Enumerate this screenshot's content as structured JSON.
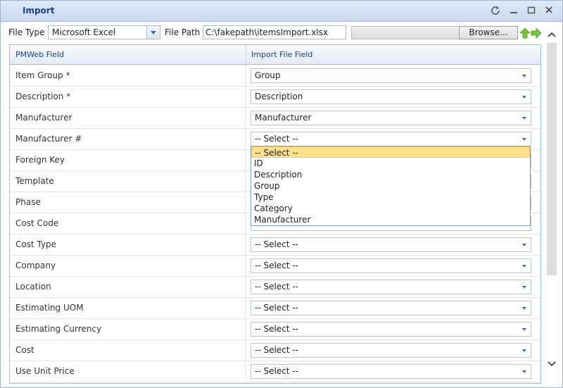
{
  "window": {
    "title": "Import"
  },
  "toolbar": {
    "file_type_label": "File Type",
    "file_type_value": "Microsoft Excel",
    "file_path_label": "File Path",
    "file_path_value": "C:\\fakepath\\itemsImport.xlsx",
    "browse_label": "Browse..."
  },
  "grid": {
    "col1": "PMWeb Field",
    "col2": "Import File Field",
    "rows": [
      {
        "field": "Item Group  *",
        "value": "Group"
      },
      {
        "field": "Description  *",
        "value": "Description"
      },
      {
        "field": "Manufacturer",
        "value": "Manufacturer"
      },
      {
        "field": "Manufacturer #",
        "value": "-- Select --"
      },
      {
        "field": "Foreign Key",
        "value": ""
      },
      {
        "field": "Template",
        "value": ""
      },
      {
        "field": "Phase",
        "value": ""
      },
      {
        "field": "Cost Code",
        "value": ""
      },
      {
        "field": "Cost Type",
        "value": "-- Select --"
      },
      {
        "field": "Company",
        "value": "-- Select --"
      },
      {
        "field": "Location",
        "value": "-- Select --"
      },
      {
        "field": "Estimating UOM",
        "value": "-- Select --"
      },
      {
        "field": "Estimating Currency",
        "value": "-- Select --"
      },
      {
        "field": "Cost",
        "value": "-- Select --"
      },
      {
        "field": "Use Unit Price",
        "value": "-- Select --"
      }
    ]
  },
  "dropdown": {
    "options": [
      "-- Select --",
      "ID",
      "Description",
      "Group",
      "Type",
      "Category",
      "Manufacturer"
    ],
    "selected": "-- Select --"
  },
  "icons": [
    "refresh-icon",
    "minimize-icon",
    "maximize-icon",
    "close-icon",
    "up-arrow-icon",
    "right-arrow-icon",
    "chevron-up-icon",
    "chevron-down-icon"
  ],
  "colors": {
    "title": "#15428b",
    "highlight": "#ffe28c",
    "arrow_green": "#7cc242"
  }
}
